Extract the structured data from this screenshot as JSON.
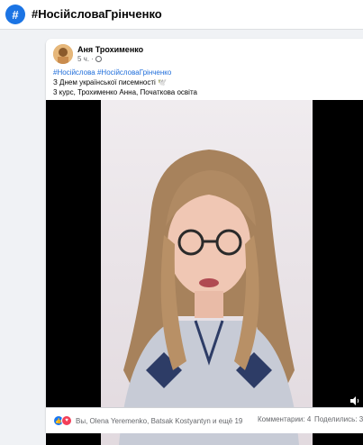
{
  "header": {
    "icon": "hashtag-icon",
    "title": "#НосійсловаГрінченко"
  },
  "post": {
    "author": "Аня Трохименко",
    "time": "5 ч.",
    "separator": "·",
    "privacy_icon": "globe-icon",
    "hashtags": [
      "#Носійслова",
      "#НосійсловаГрінченко"
    ],
    "line2": "З Днем української писемності 🕊️",
    "line3": "3 курс, Трохименко Анна, Початкова освіта",
    "video_icon": "volume-icon"
  },
  "footer": {
    "reactions_text": "Вы, Olena Yeremenko, Batsak Kostyantyn и ещё 19",
    "comments": "Комментарии: 4",
    "shares": "Поделились: 3"
  },
  "colors": {
    "accent": "#1877f2",
    "hashtag": "#216fdb",
    "love": "#f33e58"
  }
}
